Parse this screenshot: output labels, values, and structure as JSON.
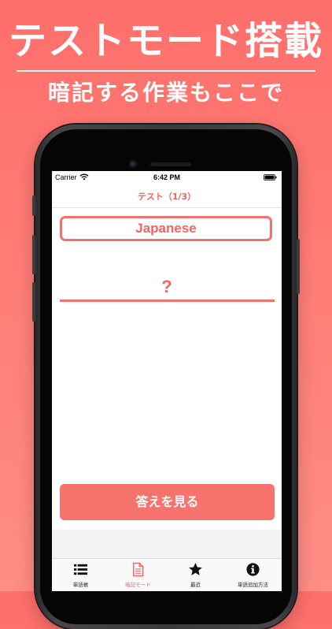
{
  "promo": {
    "title": "テストモード搭載",
    "subtitle": "暗記する作業もここで"
  },
  "status_bar": {
    "carrier": "Carrier",
    "time": "6:42 PM"
  },
  "nav": {
    "title": "テスト（1/3）"
  },
  "quiz": {
    "question": "Japanese",
    "answer": "?"
  },
  "reveal_button": {
    "label": "答えを見る"
  },
  "tabs": [
    {
      "label": "単語帳",
      "icon": "list-icon",
      "active": false
    },
    {
      "label": "暗記モード",
      "icon": "document-icon",
      "active": true
    },
    {
      "label": "最近",
      "icon": "star-icon",
      "active": false
    },
    {
      "label": "単語追加方法",
      "icon": "info-icon",
      "active": false
    }
  ],
  "colors": {
    "accent": "#f0655f",
    "button": "#f6746d",
    "background": "#ff7c76"
  }
}
